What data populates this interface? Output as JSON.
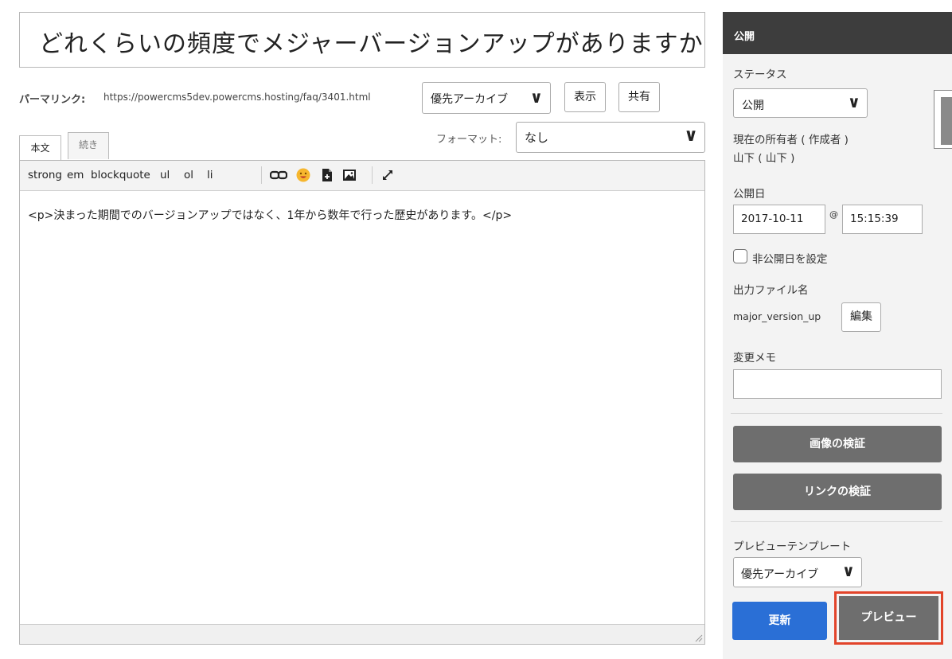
{
  "title": "どれくらいの頻度でメジャーバージョンアップがありますか",
  "permalink": {
    "label": "パーマリンク:",
    "url": "https://powercms5dev.powercms.hosting/faq/3401.html",
    "archive_select": "優先アーカイブ",
    "view_label": "表示",
    "share_label": "共有"
  },
  "tabs": {
    "body": "本文",
    "continue": "続き"
  },
  "format": {
    "label": "フォーマット:",
    "value": "なし"
  },
  "toolbar": {
    "strong": "strong",
    "em": "em",
    "blockquote": "blockquote",
    "ul": "ul",
    "ol": "ol",
    "li": "li",
    "icons": [
      "link-icon",
      "emoji-icon",
      "file-icon",
      "image-icon",
      "expand-icon"
    ]
  },
  "editor": {
    "content": "<p>決まった期間でのバージョンアップではなく、1年から数年で行った歴史があります。</p>"
  },
  "sidebar": {
    "header": "公開",
    "status_label": "ステータス",
    "status_value": "公開",
    "owner_label": "現在の所有者 ( 作成者 )",
    "owner_value": "山下 ( 山下 )",
    "publish_date_label": "公開日",
    "publish_date": "2017-10-11",
    "at": "@",
    "publish_time": "15:15:39",
    "unpublish_label": "非公開日を設定",
    "filename_label": "出力ファイル名",
    "filename": "major_version_up",
    "edit_label": "編集",
    "memo_label": "変更メモ",
    "memo_value": "",
    "verify_images": "画像の検証",
    "verify_links": "リンクの検証",
    "preview_template_label": "プレビューテンプレート",
    "preview_template_value": "優先アーカイブ",
    "update_label": "更新",
    "preview_label": "プレビュー"
  },
  "colors": {
    "primary": "#2a6fd6",
    "header": "#3d3d3d",
    "highlight": "#e2442a"
  }
}
